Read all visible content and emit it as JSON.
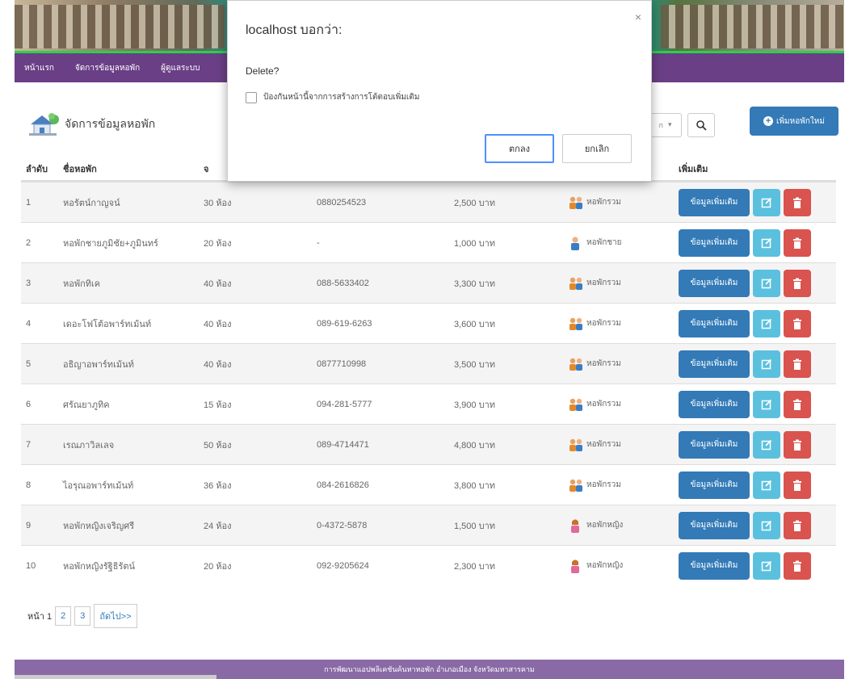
{
  "nav": {
    "items": [
      "หน้าแรก",
      "จัดการข้อมูลหอพัก",
      "ผู้ดูแลระบบ"
    ]
  },
  "page": {
    "title": "จัดการข้อมูลหอพัก"
  },
  "search": {
    "select_tail": "ก"
  },
  "toolbar": {
    "add_label": "เพิ่มหอพักใหม่"
  },
  "table": {
    "headers": [
      "ลำดับ",
      "ชื่อหอพัก",
      "จ",
      "",
      "",
      "",
      "เพิ่มเติม"
    ],
    "rows": [
      {
        "no": "1",
        "name": "หอรัตน์กาญจน์",
        "rooms": "30 ห้อง",
        "phone": "0880254523",
        "price": "2,500 บาท",
        "type": "หอพักรวม",
        "icon": "mixed"
      },
      {
        "no": "2",
        "name": "หอพักชายภูมิชัย+ภูมินทร์",
        "rooms": "20 ห้อง",
        "phone": "-",
        "price": "1,000 บาท",
        "type": "หอพักชาย",
        "icon": "male"
      },
      {
        "no": "3",
        "name": "หอพักทิเค",
        "rooms": "40 ห้อง",
        "phone": "088-5633402",
        "price": "3,300 บาท",
        "type": "หอพักรวม",
        "icon": "mixed"
      },
      {
        "no": "4",
        "name": "เดอะโฟโต้อพาร์ทเม้นท์",
        "rooms": "40 ห้อง",
        "phone": "089-619-6263",
        "price": "3,600 บาท",
        "type": "หอพักรวม",
        "icon": "mixed"
      },
      {
        "no": "5",
        "name": "อธิญาอพาร์ทเม้นท์",
        "rooms": "40 ห้อง",
        "phone": "0877710998",
        "price": "3,500 บาท",
        "type": "หอพักรวม",
        "icon": "mixed"
      },
      {
        "no": "6",
        "name": "ศรัณยาภูทิค",
        "rooms": "15 ห้อง",
        "phone": "094-281-5777",
        "price": "3,900 บาท",
        "type": "หอพักรวม",
        "icon": "mixed"
      },
      {
        "no": "7",
        "name": "เรณภาวิลเลจ",
        "rooms": "50 ห้อง",
        "phone": "089-4714471",
        "price": "4,800 บาท",
        "type": "หอพักรวม",
        "icon": "mixed"
      },
      {
        "no": "8",
        "name": "ไอรุณอพาร์ทเม้นท์",
        "rooms": "36 ห้อง",
        "phone": "084-2616826",
        "price": "3,800 บาท",
        "type": "หอพักรวม",
        "icon": "mixed"
      },
      {
        "no": "9",
        "name": "หอพักหญิงเจริญศรี",
        "rooms": "24 ห้อง",
        "phone": "0-4372-5878",
        "price": "1,500 บาท",
        "type": "หอพักหญิง",
        "icon": "female"
      },
      {
        "no": "10",
        "name": "หอพักหญิงรัฐิธิรัตน์",
        "rooms": "20 ห้อง",
        "phone": "092-9205624",
        "price": "2,300 บาท",
        "type": "หอพักหญิง",
        "icon": "female"
      }
    ],
    "more_label": "ข้อมูลเพิ่มเติม"
  },
  "pager": {
    "label": "หน้า 1",
    "pages": [
      "2",
      "3"
    ],
    "next": "ถัดไป>>"
  },
  "footer": {
    "text": "การพัฒนาแอปพลิเคชันค้นหาหอพัก อำเภอเมือง จังหวัดมหาสารคาม"
  },
  "dialog": {
    "title": "localhost บอกว่า:",
    "close": "×",
    "message": "Delete?",
    "checkbox_label": "ป้องกันหน้านี้จากการสร้างการโต้ตอบเพิ่มเติม",
    "ok": "ตกลง",
    "cancel": "ยกเลิก"
  },
  "colors": {
    "nav": "#6a3f86",
    "primary": "#337ab7",
    "info": "#5bc0de",
    "danger": "#d9534f",
    "footer": "#8a6aa6"
  }
}
